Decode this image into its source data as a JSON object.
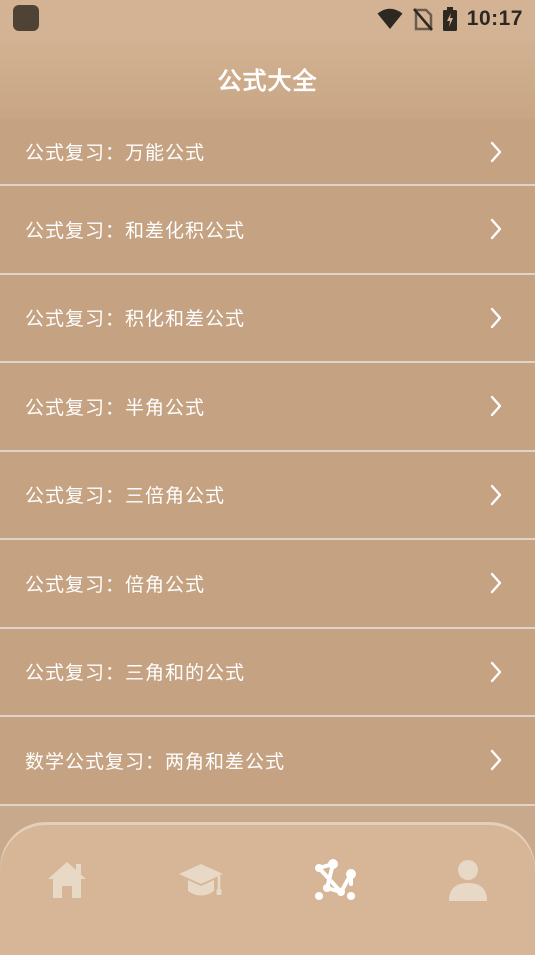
{
  "status_bar": {
    "time": "10:17",
    "icons": [
      "app-icon",
      "wifi-icon",
      "no-sim-icon",
      "battery-charging-icon"
    ]
  },
  "header": {
    "title": "公式大全"
  },
  "list": {
    "items": [
      {
        "label": "公式复习：万能公式"
      },
      {
        "label": "公式复习：和差化积公式"
      },
      {
        "label": "公式复习：积化和差公式"
      },
      {
        "label": "公式复习：半角公式"
      },
      {
        "label": "公式复习：三倍角公式"
      },
      {
        "label": "公式复习：倍角公式"
      },
      {
        "label": "公式复习：三角和的公式"
      },
      {
        "label": "数学公式复习：两角和差公式"
      }
    ]
  },
  "bottom_nav": {
    "tabs": [
      {
        "icon": "home-icon",
        "active": false
      },
      {
        "icon": "graduation-cap-icon",
        "active": false
      },
      {
        "icon": "formula-nodes-icon",
        "active": true
      },
      {
        "icon": "user-icon",
        "active": false
      }
    ]
  },
  "colors": {
    "background": "#c9a98b",
    "list_item": "#c5a282",
    "divider": "#e0d4c8",
    "nav_background": "#d6b696",
    "icon_inactive": "#e8d8c6",
    "icon_active": "#ffffff",
    "text": "#ffffff"
  }
}
